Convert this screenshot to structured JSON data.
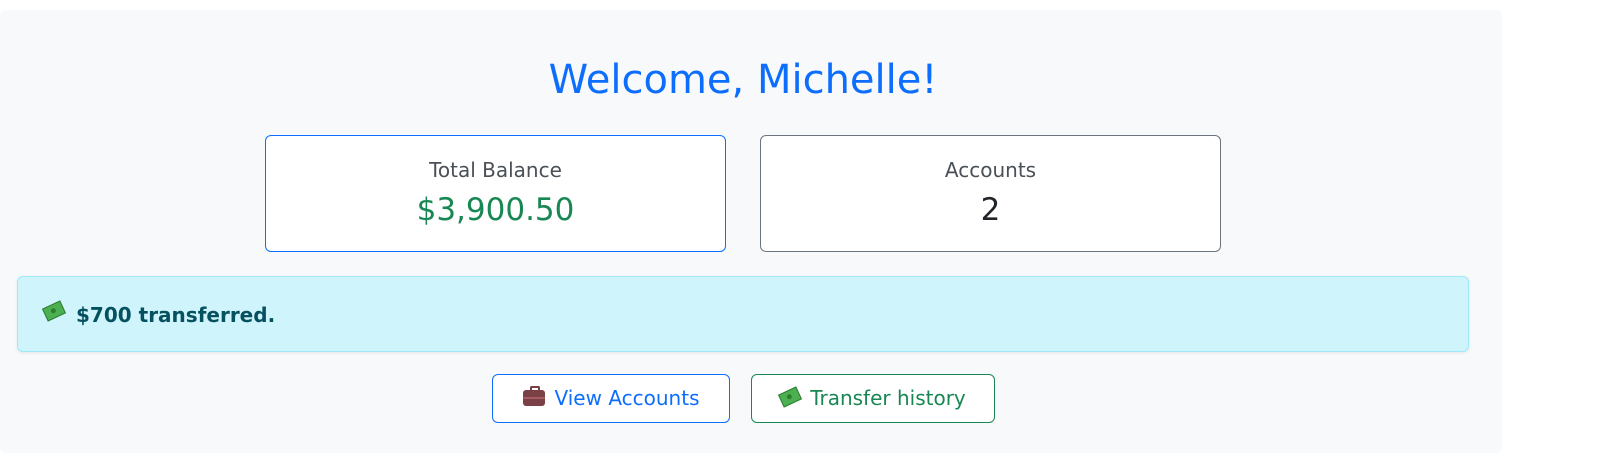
{
  "header": {
    "title": "Welcome, Michelle!"
  },
  "summary": {
    "balance_label": "Total Balance",
    "balance_value": "$3,900.50",
    "accounts_label": "Accounts",
    "accounts_value": "2"
  },
  "alert": {
    "icon": "money-with-wings-icon",
    "message": "$700 transferred."
  },
  "actions": {
    "view_accounts_label": "View Accounts",
    "view_accounts_icon": "briefcase-icon",
    "transfer_history_label": "Transfer history",
    "transfer_history_icon": "money-with-wings-icon"
  },
  "colors": {
    "primary": "#0d6efd",
    "success": "#198754",
    "info_bg": "#cff4fc",
    "info_text": "#055160"
  }
}
